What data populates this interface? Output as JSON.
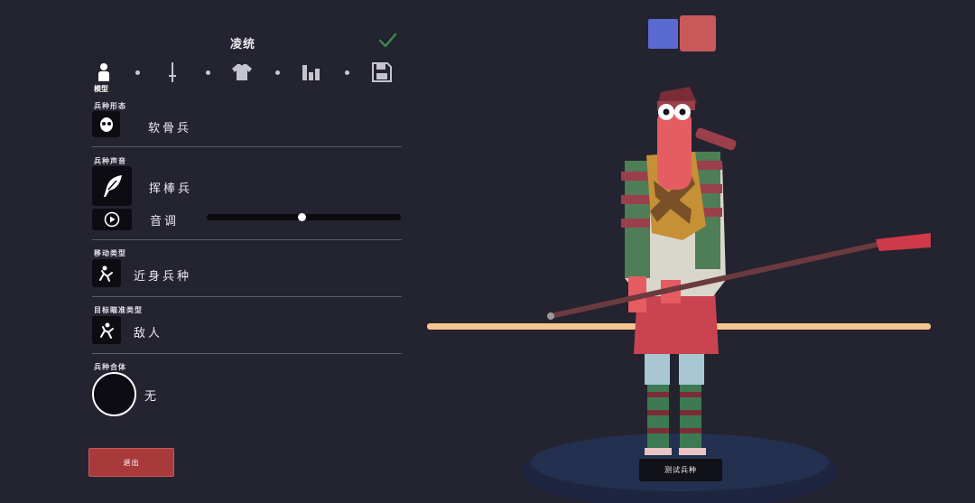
{
  "header": {
    "title": "凌统"
  },
  "tabs": [
    {
      "name": "model",
      "icon": "person-icon",
      "label": "模型"
    },
    {
      "name": "weapons",
      "icon": "sword-icon"
    },
    {
      "name": "clothing",
      "icon": "shirt-icon"
    },
    {
      "name": "stats",
      "icon": "bar-chart-icon"
    },
    {
      "name": "save",
      "icon": "floppy-disk-icon"
    }
  ],
  "sections": {
    "unit_form": {
      "label": "兵种形态",
      "value": "软骨兵"
    },
    "unit_voice": {
      "label": "兵种声音",
      "value": "挥棒兵",
      "pitch_label": "音调",
      "pitch_level": 0.49
    },
    "movement": {
      "label": "移动类型",
      "value": "近身兵种"
    },
    "targeting": {
      "label": "目标瞄准类型",
      "value": "敌人"
    },
    "combination": {
      "label": "兵种合体",
      "value": "无"
    }
  },
  "buttons": {
    "exit": "退出",
    "test_unit": "测试兵种"
  },
  "teams": [
    {
      "name": "blue",
      "color": "#5a6ad0"
    },
    {
      "name": "red",
      "color": "#c9585a"
    }
  ],
  "colors": {
    "background": "#242330",
    "accent_red": "#a83a3c",
    "check_green": "#3f7a52"
  }
}
